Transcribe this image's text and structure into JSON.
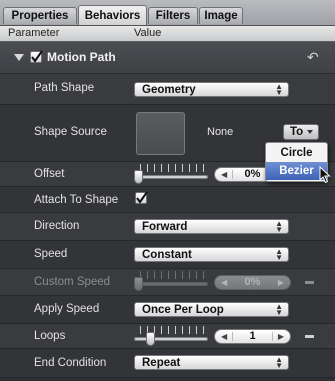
{
  "tabs": [
    "Properties",
    "Behaviors",
    "Filters",
    "Image"
  ],
  "active_tab": "Behaviors",
  "columns": {
    "parameter": "Parameter",
    "value": "Value"
  },
  "group": {
    "title": "Motion Path",
    "enabled": true,
    "reset_icon": "reset-arrow-icon"
  },
  "rows": {
    "path_shape": {
      "label": "Path Shape",
      "value": "Geometry"
    },
    "shape_source": {
      "label": "Shape Source",
      "value": "None",
      "to_button": "To"
    },
    "offset": {
      "label": "Offset",
      "value": "0%",
      "slider_fraction": 0.0
    },
    "attach_to_shape": {
      "label": "Attach To Shape",
      "checked": true
    },
    "direction": {
      "label": "Direction",
      "value": "Forward"
    },
    "speed": {
      "label": "Speed",
      "value": "Constant"
    },
    "custom_speed": {
      "label": "Custom Speed",
      "value": "0%",
      "slider_fraction": 0.0,
      "disabled": true
    },
    "apply_speed": {
      "label": "Apply Speed",
      "value": "Once Per Loop"
    },
    "loops": {
      "label": "Loops",
      "value": "1"
    },
    "end_condition": {
      "label": "End Condition",
      "value": "Repeat"
    }
  },
  "menu": {
    "items": [
      "Circle",
      "Bezier"
    ],
    "highlighted": "Bezier"
  },
  "colors": {
    "panel_bg": "#2f3033",
    "menu_highlight": "#4a6ec0"
  }
}
